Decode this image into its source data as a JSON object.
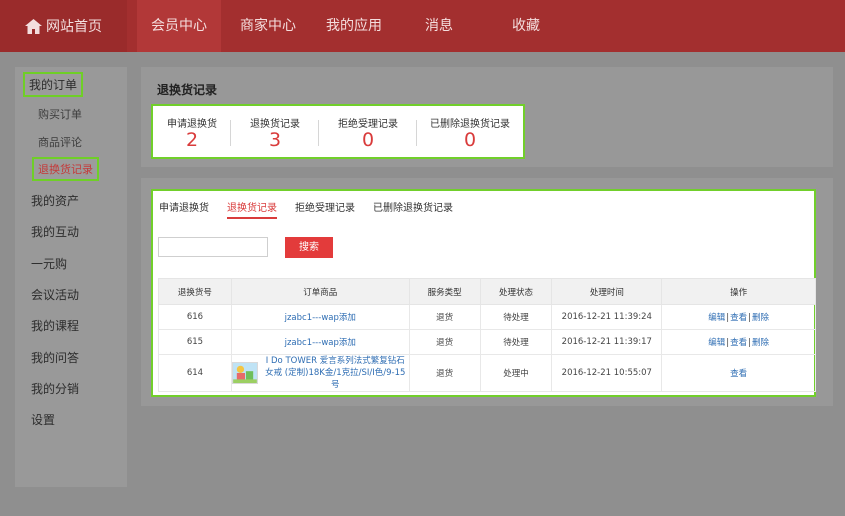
{
  "nav": {
    "home": "网站首页",
    "items": [
      "会员中心",
      "商家中心",
      "我的应用",
      "消息",
      "收藏"
    ]
  },
  "sidebar": {
    "orders": "我的订单",
    "sub": [
      "购买订单",
      "商品评论",
      "退换货记录"
    ],
    "items": [
      "我的资产",
      "我的互动",
      "一元购",
      "会议活动",
      "我的课程",
      "我的问答",
      "我的分销",
      "设置"
    ]
  },
  "panel": {
    "title": "退换货记录",
    "stats": [
      {
        "label": "申请退换货",
        "value": "2"
      },
      {
        "label": "退换货记录",
        "value": "3"
      },
      {
        "label": "拒绝受理记录",
        "value": "0"
      },
      {
        "label": "已删除退换货记录",
        "value": "0"
      }
    ]
  },
  "tabs": [
    "申请退换货",
    "退换货记录",
    "拒绝受理记录",
    "已删除退换货记录"
  ],
  "search": {
    "placeholder": "",
    "button": "搜索"
  },
  "table": {
    "headers": [
      "退换货号",
      "订单商品",
      "服务类型",
      "处理状态",
      "处理时间",
      "操作"
    ],
    "rows": [
      {
        "id": "616",
        "product": "jzabc1---wap添加",
        "service": "退货",
        "status": "待处理",
        "time": "2016-12-21 11:39:24",
        "ops": [
          "编辑",
          "查看",
          "删除"
        ]
      },
      {
        "id": "615",
        "product": "jzabc1---wap添加",
        "service": "退货",
        "status": "待处理",
        "time": "2016-12-21 11:39:17",
        "ops": [
          "编辑",
          "查看",
          "删除"
        ]
      },
      {
        "id": "614",
        "product_line1": "I Do TOWER 爱言系列法式繁复钻石",
        "product_line2": "女戒 (定制)18K金/1克拉/SI/I色/9-15号",
        "service": "退货",
        "status": "处理中",
        "time": "2016-12-21 10:55:07",
        "ops": [
          "查看"
        ]
      }
    ],
    "sep": "|"
  },
  "colors": {
    "accent": "#d93b3b",
    "highlight": "#71cf2b",
    "link": "#2e6db3"
  }
}
